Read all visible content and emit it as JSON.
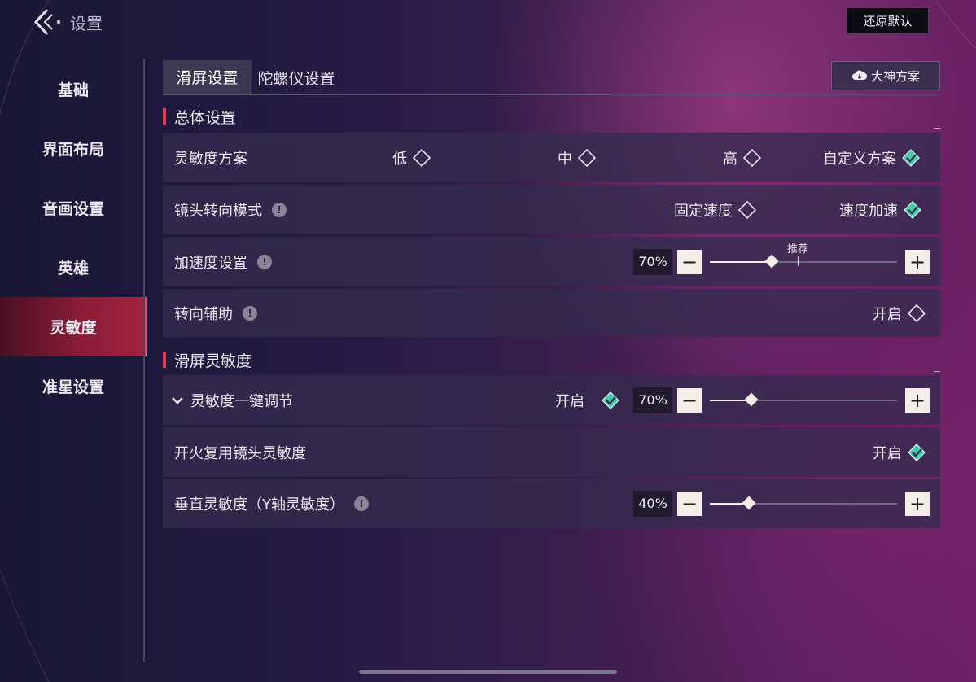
{
  "header": {
    "title": "设置",
    "reset_label": "还原默认"
  },
  "sidebar": {
    "items": [
      {
        "label": "基础",
        "active": false
      },
      {
        "label": "界面布局",
        "active": false
      },
      {
        "label": "音画设置",
        "active": false
      },
      {
        "label": "英雄",
        "active": false
      },
      {
        "label": "灵敏度",
        "active": true
      },
      {
        "label": "准星设置",
        "active": false
      }
    ]
  },
  "tabs": [
    {
      "label": "滑屏设置",
      "active": true
    },
    {
      "label": "陀螺仪设置",
      "active": false
    }
  ],
  "pro_button": {
    "label": "大神方案",
    "icon": "cloud-download-icon"
  },
  "sections": {
    "general": {
      "title": "总体设置",
      "sensitivity_scheme": {
        "label": "灵敏度方案",
        "options": [
          {
            "label": "低",
            "selected": false
          },
          {
            "label": "中",
            "selected": false
          },
          {
            "label": "高",
            "selected": false
          },
          {
            "label": "自定义方案",
            "selected": true
          }
        ]
      },
      "camera_turn_mode": {
        "label": "镜头转向模式",
        "options": [
          {
            "label": "固定速度",
            "selected": false
          },
          {
            "label": "速度加速",
            "selected": true
          }
        ]
      },
      "acceleration": {
        "label": "加速度设置",
        "value_text": "70%",
        "value": 0.7,
        "recommend_label": "推荐",
        "recommend_value": 0.47
      },
      "turn_assist": {
        "label": "转向辅助",
        "option_label": "开启",
        "enabled": false
      }
    },
    "swipe": {
      "title": "滑屏灵敏度",
      "one_key": {
        "label": "灵敏度一键调节",
        "option_label": "开启",
        "enabled": true,
        "value_text": "70%",
        "value": 0.7
      },
      "fire_reuse": {
        "label": "开火复用镜头灵敏度",
        "option_label": "开启",
        "enabled": true
      },
      "vertical": {
        "label": "垂直灵敏度（Y轴灵敏度）",
        "value_text": "40%",
        "value": 0.4
      }
    }
  },
  "colors": {
    "accent": "#e8384f",
    "check": "#49c9b3"
  },
  "stepper": {
    "minus": "−",
    "plus": "+"
  },
  "info_glyph": "!"
}
